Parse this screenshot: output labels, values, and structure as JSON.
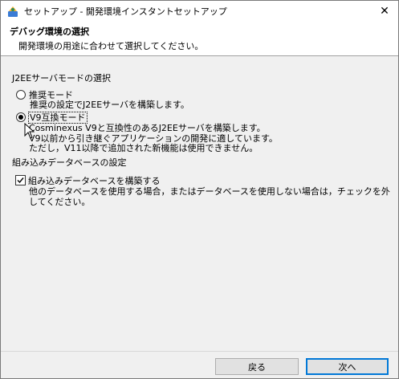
{
  "window": {
    "title": "セットアップ - 開発環境インスタントセットアップ",
    "close_label": "✕"
  },
  "header": {
    "title": "デバッグ環境の選択",
    "description": "開発環境の用途に合わせて選択してください。"
  },
  "server_mode": {
    "group_label": "J2EEサーバモードの選択",
    "options": [
      {
        "label": "推奨モード",
        "selected": false,
        "description": [
          "推奨の設定でJ2EEサーバを構築します。"
        ]
      },
      {
        "label": "V9互換モード",
        "selected": true,
        "description": [
          "Cosminexus V9と互換性のあるJ2EEサーバを構築します。",
          "V9以前から引き継ぐアプリケーションの開発に適しています。",
          "ただし，V11以降で追加された新機能は使用できません。"
        ]
      }
    ]
  },
  "database": {
    "group_label": "組み込みデータベースの設定",
    "checkbox_label": "組み込みデータベースを構築する",
    "checked": true,
    "description": "他のデータベースを使用する場合，またはデータベースを使用しない場合は，チェックを外してください。"
  },
  "footer": {
    "back_label": "戻る",
    "next_label": "次へ"
  }
}
